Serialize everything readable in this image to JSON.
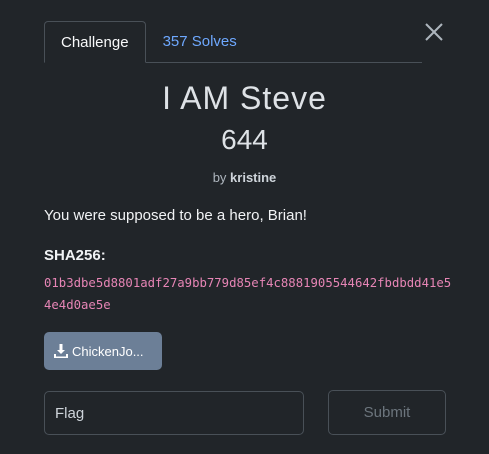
{
  "tabs": [
    {
      "label": "Challenge",
      "active": true
    },
    {
      "label": "357 Solves",
      "active": false
    }
  ],
  "challenge": {
    "name": "I AM Steve",
    "points": "644",
    "author_prefix": "by",
    "author": "kristine",
    "description": "You were supposed to be a hero, Brian!",
    "sha_label": "SHA256:",
    "sha_value": "01b3dbe5d8801adf27a9bb779d85ef4c8881905544642fbdbdd41e54e4d0ae5e"
  },
  "file": {
    "label": "ChickenJo..."
  },
  "flag_input": {
    "placeholder": "Flag",
    "value": ""
  },
  "submit": {
    "label": "Submit"
  },
  "colors": {
    "background": "#212529",
    "tab_link": "#6ea8fe",
    "hash": "#e685b5",
    "file_button": "#6c7f97"
  },
  "icons": {
    "close": "close-icon",
    "download": "download-icon"
  }
}
